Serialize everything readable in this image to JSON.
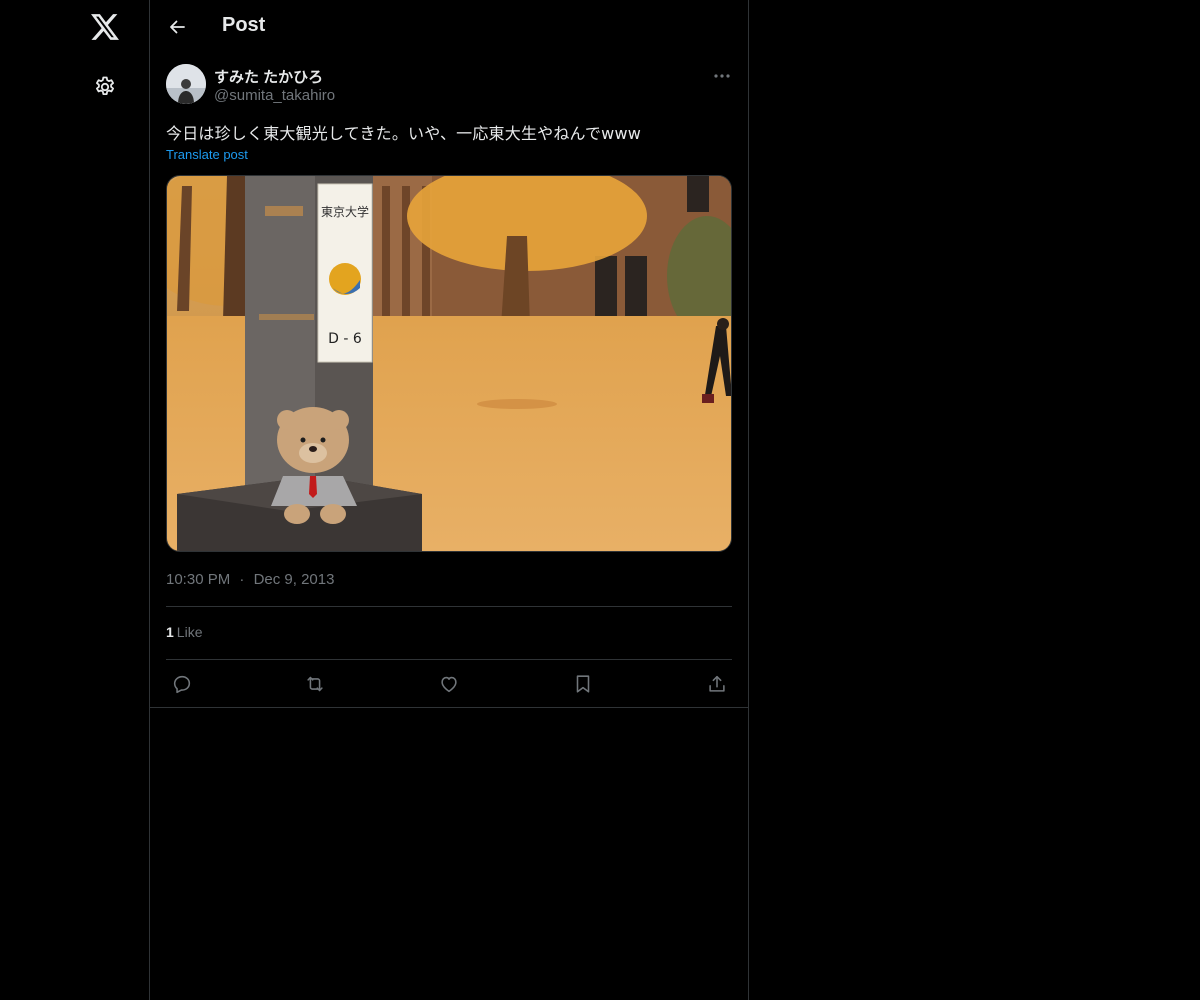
{
  "nav": {
    "logo_icon": "x-logo-icon",
    "settings_icon": "gear-icon"
  },
  "header": {
    "back_icon": "arrow-left-icon",
    "title": "Post"
  },
  "post": {
    "author": {
      "display_name": "すみた たかひろ",
      "handle": "@sumita_takahiro"
    },
    "text": "今日は珍しく東大観光してきた。いや、一応東大生やねんでwww",
    "translate_label": "Translate post",
    "media": {
      "sign_text": "東京大学",
      "sign_code": "D - 6"
    },
    "time": "10:30 PM",
    "separator": "·",
    "date": "Dec 9, 2013",
    "likes": {
      "count": "1",
      "label": "Like"
    },
    "actions": [
      "reply-icon",
      "repost-icon",
      "like-icon",
      "bookmark-icon",
      "share-icon"
    ]
  },
  "colors": {
    "background": "#000000",
    "text": "#e7e9ea",
    "secondary_text": "#71767b",
    "link": "#1d9bf0",
    "border": "#2f3336"
  }
}
